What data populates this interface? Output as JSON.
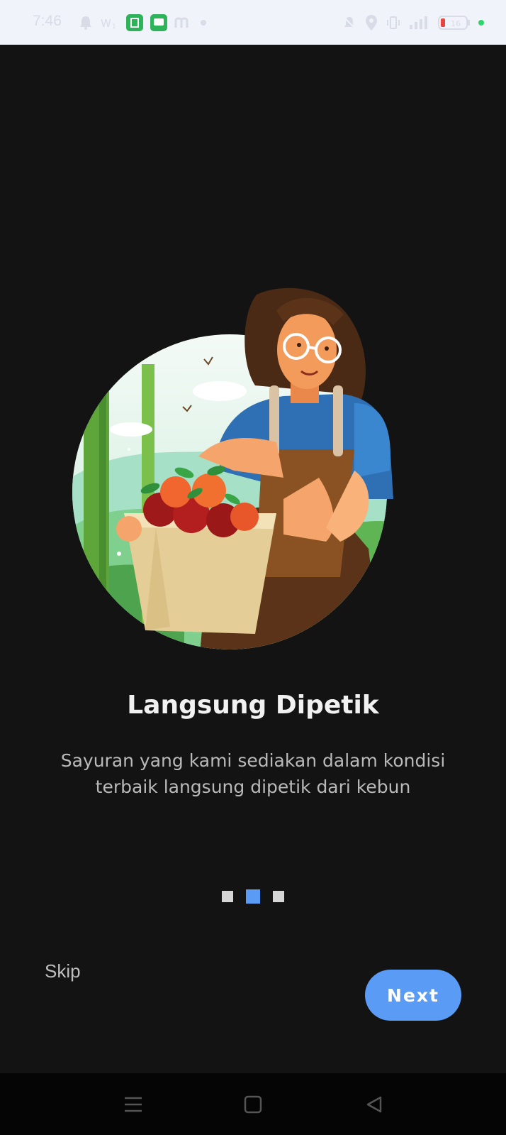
{
  "status_bar": {
    "time": "7:46",
    "left_icons": [
      "notification-bell-icon",
      "wifi-calling-icon",
      "store-app-icon",
      "message-app-icon",
      "m-app-icon",
      "dot-icon"
    ],
    "right_icons": [
      "mute-icon",
      "location-icon",
      "vibrate-icon",
      "signal-icon",
      "battery-icon",
      "active-dot-icon"
    ],
    "battery_level": "16"
  },
  "onboarding": {
    "title": "Langsung Dipetik",
    "description": "Sayuran yang kami sediakan dalam kondisi terbaik langsung dipetik dari kebun",
    "page_count": 3,
    "active_page": 2,
    "skip_label": "Skip",
    "next_label": "Next"
  },
  "colors": {
    "background": "#131313",
    "accent": "#5a9cf5",
    "status_bar": "#f1f3fb",
    "nav_bar": "#050505"
  },
  "nav_bar": {
    "buttons": [
      "menu-icon",
      "home-square-icon",
      "back-triangle-icon"
    ]
  }
}
